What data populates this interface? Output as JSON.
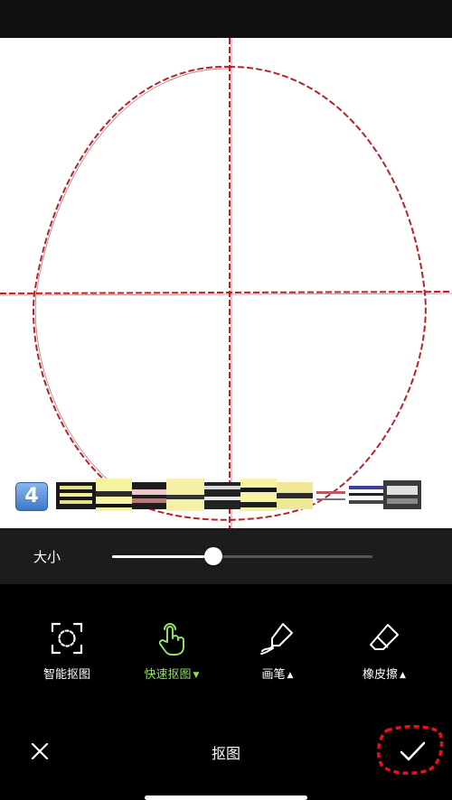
{
  "canvas": {
    "step_badge": "4"
  },
  "slider": {
    "label": "大小",
    "value": 0.39
  },
  "tools": [
    {
      "label": "智能抠图",
      "icon": "smart-cutout-icon",
      "active": false,
      "has_menu": false
    },
    {
      "label": "快速抠图",
      "icon": "hand-touch-icon",
      "active": true,
      "has_menu": true
    },
    {
      "label": "画笔",
      "icon": "brush-icon",
      "active": false,
      "has_menu": true
    },
    {
      "label": "橡皮擦",
      "icon": "eraser-icon",
      "active": false,
      "has_menu": true
    }
  ],
  "bottom": {
    "title": "抠图",
    "close_icon": "close-icon",
    "confirm_icon": "check-icon"
  },
  "colors": {
    "accent": "#8fe05a",
    "sketch_line": "#c0141e",
    "annotation": "#e8101e"
  }
}
